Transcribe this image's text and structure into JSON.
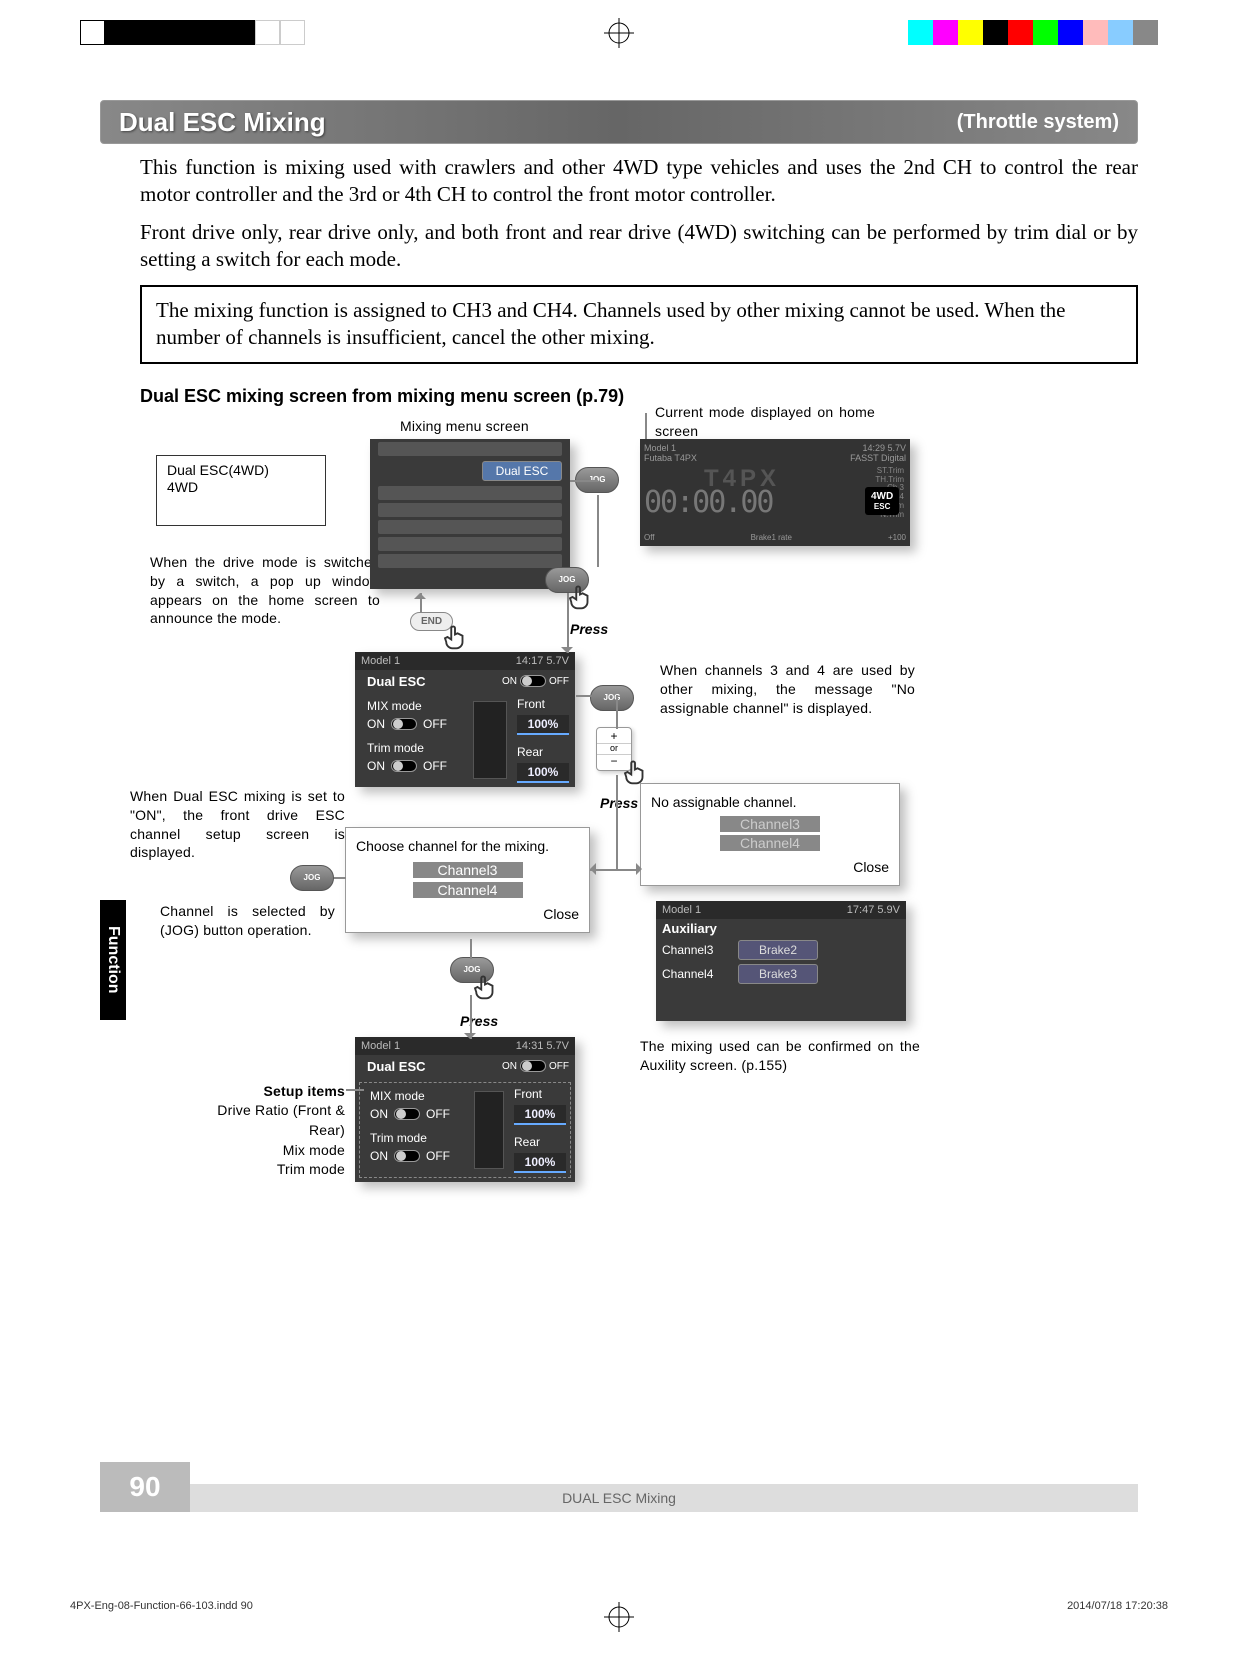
{
  "header": {
    "title": "Dual ESC Mixing",
    "subtitle": "(Throttle system)"
  },
  "intro": {
    "p1": "This function is mixing used with crawlers and other 4WD type vehicles and uses the 2nd CH to control the rear motor controller and the 3rd or 4th CH to control the front motor controller.",
    "p2": "Front drive only, rear drive only, and both front and rear drive (4WD) switching can be performed by trim dial or by setting a switch for each mode.",
    "note": "The mixing function is assigned to CH3 and CH4. Channels used by other mixing cannot be used. When the number of channels is insufficient, cancel the other mixing."
  },
  "section": "Dual ESC mixing screen from mixing menu screen (p.79)",
  "labels": {
    "mixing_menu": "Mixing menu screen",
    "current_mode": "Current mode displayed on home screen",
    "popup_note": "When the drive mode is switched by a switch, a pop up window appears on the home screen to announce the mode.",
    "on_note": "When Dual ESC mixing is set to \"ON\", the front drive ESC channel setup screen is displayed.",
    "jog_note": "Channel is selected by (JOG) button operation.",
    "setup_title": "Setup items",
    "setup1": "Drive Ratio (Front & Rear)",
    "setup2": "Mix mode",
    "setup3": "Trim mode",
    "no_assign_note": "When channels 3 and 4 are used by other mixing, the message \"No assignable channel\" is displayed.",
    "aux_note": "The mixing used can be confirmed on the Auxility screen. (p.155)",
    "press": "Press",
    "or": "or"
  },
  "mode_box": {
    "line1": "Dual ESC(4WD)",
    "line2": "4WD"
  },
  "mixing_menu": {
    "items": [
      "",
      "",
      "",
      "",
      "",
      "",
      ""
    ],
    "selected": "Dual ESC"
  },
  "home_screen": {
    "model": "Model 1",
    "time": "14:29 5.7V",
    "brand": "Futaba T4PX",
    "proto": "FASST Digital",
    "display": "00:00.00",
    "logo": "T4PX",
    "badge1": "4WD",
    "badge2": "ESC",
    "side": [
      "ST.Trim",
      "TH.Trim",
      "Ch.3",
      "Ch.4",
      "T.Trim",
      "N.Trim"
    ],
    "extra": "Brake1 rate",
    "off": "Off"
  },
  "dual_esc1": {
    "model": "Model 1",
    "time": "14:17 5.7V",
    "title": "Dual ESC",
    "on": "ON",
    "off": "OFF",
    "mix": "MIX mode",
    "trim": "Trim mode",
    "front": "Front",
    "rear": "Rear",
    "fval": "100%",
    "rval": "100%"
  },
  "dual_esc2": {
    "model": "Model 1",
    "time": "14:31 5.7V",
    "title": "Dual ESC",
    "on": "ON",
    "off": "OFF",
    "mix": "MIX mode",
    "trim": "Trim mode",
    "front": "Front",
    "rear": "Rear",
    "fval": "100%",
    "rval": "100%"
  },
  "choose_popup": {
    "title": "Choose channel for the mixing.",
    "ch3": "Channel3",
    "ch4": "Channel4",
    "close": "Close"
  },
  "no_assign_popup": {
    "title": "No assignable channel.",
    "ch3": "Channel3",
    "ch4": "Channel4",
    "close": "Close"
  },
  "aux_screen": {
    "model": "Model 1",
    "time": "17:47 5.9V",
    "title": "Auxiliary",
    "ch3": "Channel3",
    "ch4": "Channel4",
    "b2": "Brake2",
    "b3": "Brake3"
  },
  "jog": "JOG",
  "end": "END",
  "footer": {
    "title": "DUAL ESC Mixing",
    "page": "90"
  },
  "side_tab": "Function",
  "meta": {
    "file": "4PX-Eng-08-Function-66-103.indd   90",
    "ts": "2014/07/18   17:20:38"
  },
  "plusminus": {
    "plus": "+",
    "minus": "−"
  }
}
